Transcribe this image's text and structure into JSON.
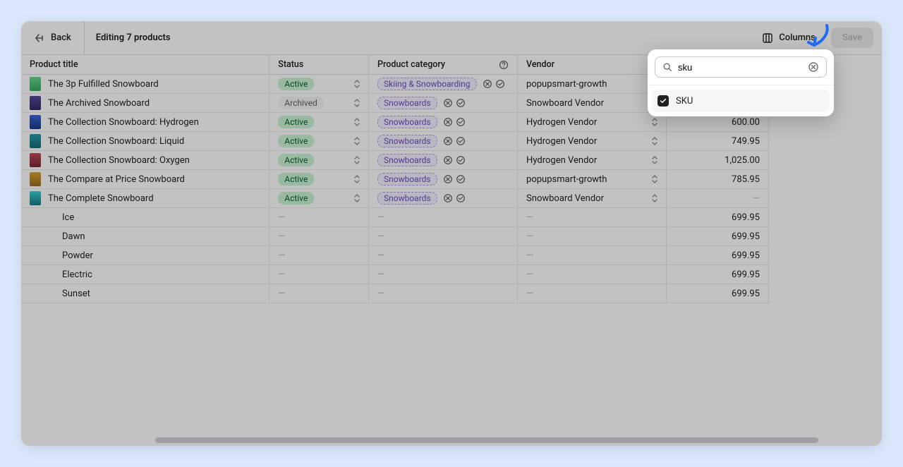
{
  "header": {
    "back_label": "Back",
    "title": "Editing 7 products",
    "columns_label": "Columns",
    "save_label": "Save"
  },
  "columns_popover": {
    "search_value": "sku",
    "options": [
      {
        "label": "SKU",
        "checked": true
      }
    ]
  },
  "table": {
    "headers": {
      "title": "Product title",
      "status": "Status",
      "category": "Product category",
      "vendor": "Vendor"
    },
    "rows": [
      {
        "type": "product",
        "thumb": "green",
        "title": "The 3p Fulfilled Snowboard",
        "status": "Active",
        "category": "Skiing & Snowboarding",
        "vendor": "popupsmart-growth",
        "price": ""
      },
      {
        "type": "product",
        "thumb": "purple",
        "title": "The Archived Snowboard",
        "status": "Archived",
        "category": "Snowboards",
        "vendor": "Snowboard Vendor",
        "price": ""
      },
      {
        "type": "product",
        "thumb": "blue",
        "title": "The Collection Snowboard: Hydrogen",
        "status": "Active",
        "category": "Snowboards",
        "vendor": "Hydrogen Vendor",
        "price": "600.00"
      },
      {
        "type": "product",
        "thumb": "teal",
        "title": "The Collection Snowboard: Liquid",
        "status": "Active",
        "category": "Snowboards",
        "vendor": "Hydrogen Vendor",
        "price": "749.95"
      },
      {
        "type": "product",
        "thumb": "red",
        "title": "The Collection Snowboard: Oxygen",
        "status": "Active",
        "category": "Snowboards",
        "vendor": "Hydrogen Vendor",
        "price": "1,025.00"
      },
      {
        "type": "product",
        "thumb": "orange",
        "title": "The Compare at Price Snowboard",
        "status": "Active",
        "category": "Snowboards",
        "vendor": "popupsmart-growth",
        "price": "785.95"
      },
      {
        "type": "product",
        "thumb": "cyan",
        "title": "The Complete Snowboard",
        "status": "Active",
        "category": "Snowboards",
        "vendor": "Snowboard Vendor",
        "price": "—"
      },
      {
        "type": "variant",
        "title": "Ice",
        "price": "699.95"
      },
      {
        "type": "variant",
        "title": "Dawn",
        "price": "699.95"
      },
      {
        "type": "variant",
        "title": "Powder",
        "price": "699.95"
      },
      {
        "type": "variant",
        "title": "Electric",
        "price": "699.95"
      },
      {
        "type": "variant",
        "title": "Sunset",
        "price": "699.95"
      }
    ]
  }
}
